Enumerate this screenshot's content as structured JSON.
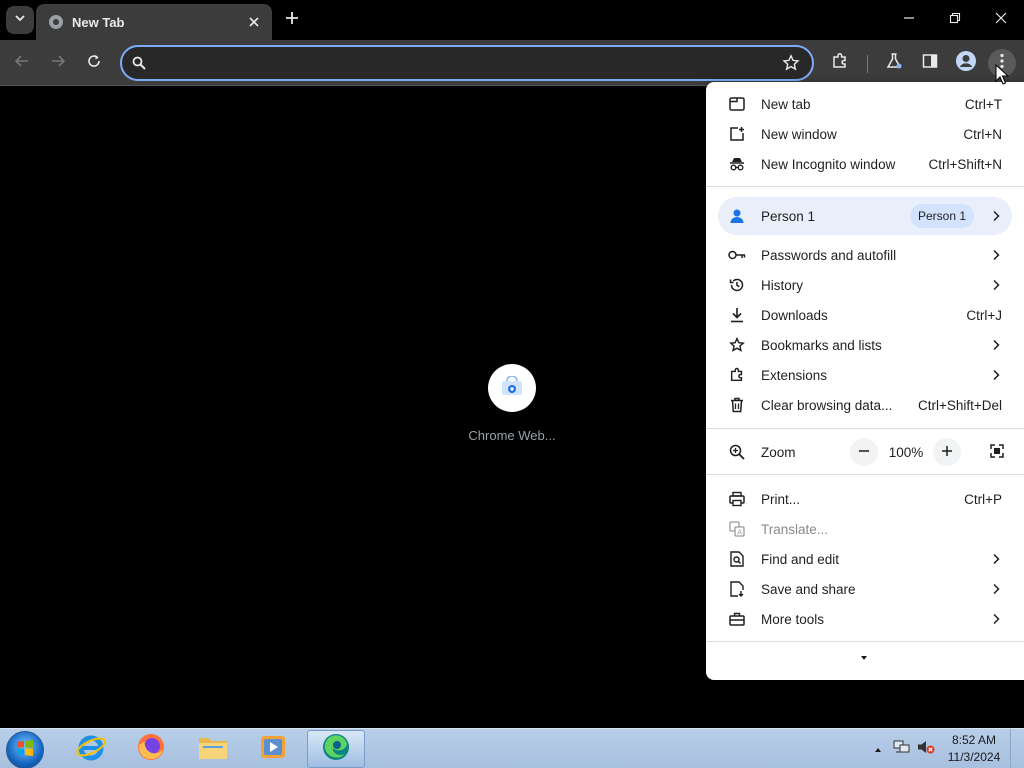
{
  "browser": {
    "tab": {
      "title": "New Tab"
    },
    "omnibox": {
      "value": "",
      "placeholder": ""
    }
  },
  "page": {
    "shortcut": {
      "label": "Chrome Web..."
    }
  },
  "menu": {
    "items_top": [
      {
        "label": "New tab",
        "accel": "Ctrl+T"
      },
      {
        "label": "New window",
        "accel": "Ctrl+N"
      },
      {
        "label": "New Incognito window",
        "accel": "Ctrl+Shift+N"
      }
    ],
    "person": {
      "label": "Person 1",
      "chip": "Person 1"
    },
    "items_mid": [
      {
        "label": "Passwords and autofill",
        "accel": ""
      },
      {
        "label": "History",
        "accel": ""
      },
      {
        "label": "Downloads",
        "accel": "Ctrl+J"
      },
      {
        "label": "Bookmarks and lists",
        "accel": ""
      },
      {
        "label": "Extensions",
        "accel": ""
      },
      {
        "label": "Clear browsing data...",
        "accel": "Ctrl+Shift+Del"
      }
    ],
    "zoom": {
      "label": "Zoom",
      "value": "100%"
    },
    "items_bottom": [
      {
        "label": "Print...",
        "accel": "Ctrl+P"
      },
      {
        "label": "Translate...",
        "accel": ""
      },
      {
        "label": "Find and edit",
        "accel": ""
      },
      {
        "label": "Save and share",
        "accel": ""
      },
      {
        "label": "More tools",
        "accel": ""
      }
    ]
  },
  "taskbar": {
    "clock": {
      "time": "8:52 AM",
      "date": "11/3/2024"
    }
  },
  "colors": {
    "omnibox_focus": "#7cacf8",
    "toolbar": "#3c3c3c",
    "menu_bg": "#ffffff",
    "person_highlight": "#e8effa"
  }
}
